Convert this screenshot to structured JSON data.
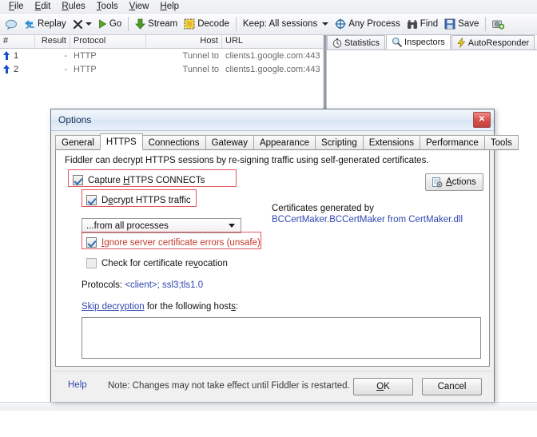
{
  "menubar": {
    "items": [
      {
        "label": "File",
        "accel": "F"
      },
      {
        "label": "Edit",
        "accel": "E"
      },
      {
        "label": "Rules",
        "accel": "R"
      },
      {
        "label": "Tools",
        "accel": "T"
      },
      {
        "label": "View",
        "accel": "V"
      },
      {
        "label": "Help",
        "accel": "H"
      }
    ]
  },
  "toolbar": {
    "comment_icon": "comment-bubble-icon",
    "replay_label": "Replay",
    "replay_icon": "replay-icon",
    "remove_label": "",
    "remove_icon": "x-remove-icon",
    "go_label": "Go",
    "go_icon": "play-green-icon",
    "stream_label": "Stream",
    "stream_icon": "stream-green-arrow-icon",
    "decode_label": "Decode",
    "decode_icon": "decode-icon",
    "keep_label": "Keep: All sessions",
    "process_label": "Any Process",
    "process_icon": "target-crosshair-icon",
    "find_label": "Find",
    "find_icon": "binoculars-icon",
    "save_label": "Save",
    "save_icon": "save-disk-icon",
    "capture_icon": "camera-icon"
  },
  "grid": {
    "columns": [
      "#",
      "Result",
      "Protocol",
      "Host",
      "URL"
    ],
    "rows": [
      {
        "num": "1",
        "result": "-",
        "protocol": "HTTP",
        "host": "Tunnel to",
        "url": "clients1.google.com:443",
        "icon": "blue-up-arrow-icon"
      },
      {
        "num": "2",
        "result": "-",
        "protocol": "HTTP",
        "host": "Tunnel to",
        "url": "clients1.google.com:443",
        "icon": "blue-up-arrow-icon"
      }
    ]
  },
  "right_panel": {
    "tabs": [
      {
        "label": "Statistics",
        "icon": "stopwatch-icon",
        "active": false
      },
      {
        "label": "Inspectors",
        "icon": "magnifier-icon",
        "active": true
      },
      {
        "label": "AutoResponder",
        "icon": "lightning-icon",
        "active": false
      }
    ]
  },
  "dialog": {
    "title": "Options",
    "close_icon": "close-x-icon",
    "tabs": [
      {
        "label": "General",
        "active": false
      },
      {
        "label": "HTTPS",
        "active": true
      },
      {
        "label": "Connections",
        "active": false
      },
      {
        "label": "Gateway",
        "active": false
      },
      {
        "label": "Appearance",
        "active": false
      },
      {
        "label": "Scripting",
        "active": false
      },
      {
        "label": "Extensions",
        "active": false
      },
      {
        "label": "Performance",
        "active": false
      },
      {
        "label": "Tools",
        "active": false
      }
    ],
    "description": "Fiddler can decrypt HTTPS sessions by re-signing traffic using self-generated certificates.",
    "capture_connects": {
      "label_pre": "Capture ",
      "label_accel": "H",
      "label_post": "TTPS CONNECTs",
      "checked": true
    },
    "decrypt_traffic": {
      "label_pre": "D",
      "label_accel": "e",
      "label_post": "crypt HTTPS traffic",
      "checked": true
    },
    "process_filter": {
      "value": "...from all processes"
    },
    "ignore_cert_errors": {
      "label_pre": "",
      "label_accel": "I",
      "label_post": "gnore server certificate errors (unsafe)",
      "checked": true
    },
    "check_revocation": {
      "label_pre": "Check for certificate re",
      "label_accel": "v",
      "label_post": "ocation",
      "checked": false
    },
    "actions_button": {
      "label_pre": "",
      "label_accel": "A",
      "label_post": "ctions",
      "icon": "certificate-gear-icon"
    },
    "certificates": {
      "line1": "Certificates generated by",
      "line2": "BCCertMaker.BCCertMaker from CertMaker.dll"
    },
    "protocols": {
      "label": "Protocols: ",
      "value": "<client>; ssl3;tls1.0"
    },
    "skip_decryption": {
      "link": "Skip decryption",
      "text_pre": " for the following host",
      "accel": "s",
      "text_post": ":"
    },
    "hosts_value": "",
    "footer": {
      "help_label": "Help",
      "note": "Note: Changes may not take effect until Fiddler is restarted.",
      "ok_pre": "",
      "ok_accel": "O",
      "ok_post": "K",
      "cancel_label": "Cancel"
    }
  },
  "colors": {
    "highlight_red": "#e0565f",
    "link_blue": "#2f47b0",
    "title_blue": "#15315b",
    "arrow_blue": "#1750c8"
  }
}
